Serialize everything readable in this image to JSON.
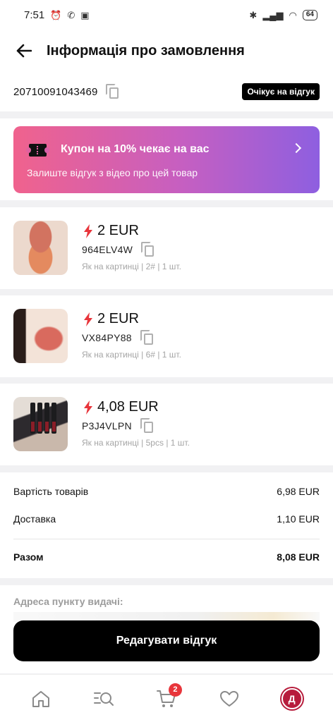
{
  "status_bar": {
    "time": "7:51",
    "battery": "64"
  },
  "header": {
    "title": "Інформація про замовлення"
  },
  "order": {
    "number": "20710091043469",
    "status": "Очікує на відгук"
  },
  "coupon": {
    "title": "Купон на 10% чекає на вас",
    "subtitle": "Залиште відгук з відео про цей товар"
  },
  "products": [
    {
      "price": "2 EUR",
      "sku": "964ELV4W",
      "variant": "Як на картинці | 2# | 1 шт."
    },
    {
      "price": "2 EUR",
      "sku": "VX84PY88",
      "variant": "Як на картинці | 6# | 1 шт."
    },
    {
      "price": "4,08 EUR",
      "sku": "P3J4VLPN",
      "variant": "Як на картинці | 5pcs | 1 шт."
    }
  ],
  "summary": {
    "items_label": "Вартість товарів",
    "items_value": "6,98 EUR",
    "shipping_label": "Доставка",
    "shipping_value": "1,10 EUR",
    "total_label": "Разом",
    "total_value": "8,08 EUR"
  },
  "pickup": {
    "label": "Адреса пункту видачі:"
  },
  "cta": {
    "label": "Редагувати відгук"
  },
  "nav": {
    "cart_count": "2",
    "avatar_letter": "Д"
  },
  "colors": {
    "accent": "#e8353b",
    "coupon_start": "#f0628d",
    "coupon_end": "#8e5fe0",
    "avatar": "#b71c3c"
  }
}
